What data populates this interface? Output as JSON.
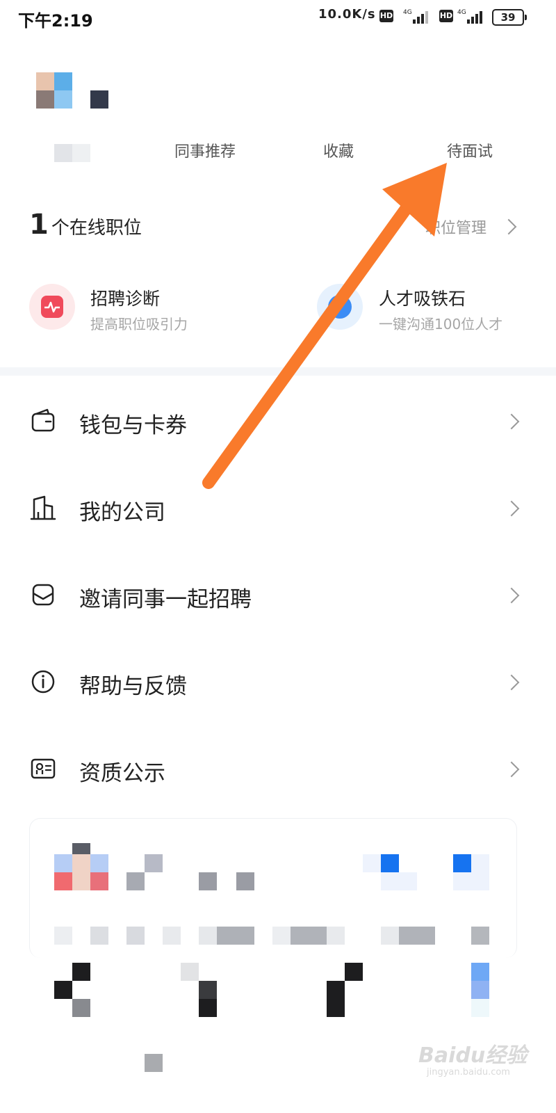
{
  "status_bar": {
    "time": "下午2:19",
    "network_speed": "10.0K/s",
    "network_type_1": "4G",
    "network_type_2": "4G",
    "hd_label": "HD",
    "battery": "39"
  },
  "counters": [
    {
      "label": "同事推荐"
    },
    {
      "label": "收藏"
    },
    {
      "label": "待面试"
    }
  ],
  "online_jobs": {
    "count": "1",
    "label": "个在线职位",
    "manage_link": "职位管理"
  },
  "tools": [
    {
      "title": "招聘诊断",
      "subtitle": "提高职位吸引力",
      "icon": "pulse-icon",
      "color": "#f04a5b"
    },
    {
      "title": "人才吸铁石",
      "subtitle": "一键沟通100位人才",
      "icon": "magnet-icon",
      "color": "#3b8cf5"
    }
  ],
  "menu": [
    {
      "label": "钱包与卡券",
      "icon": "wallet-icon"
    },
    {
      "label": "我的公司",
      "icon": "building-icon"
    },
    {
      "label": "邀请同事一起招聘",
      "icon": "invite-icon"
    },
    {
      "label": "帮助与反馈",
      "icon": "info-icon"
    },
    {
      "label": "资质公示",
      "icon": "certificate-icon"
    }
  ],
  "annotation": {
    "color": "#f97a2b"
  },
  "watermark": {
    "brand": "Baidu经验",
    "url": "jingyan.baidu.com"
  }
}
